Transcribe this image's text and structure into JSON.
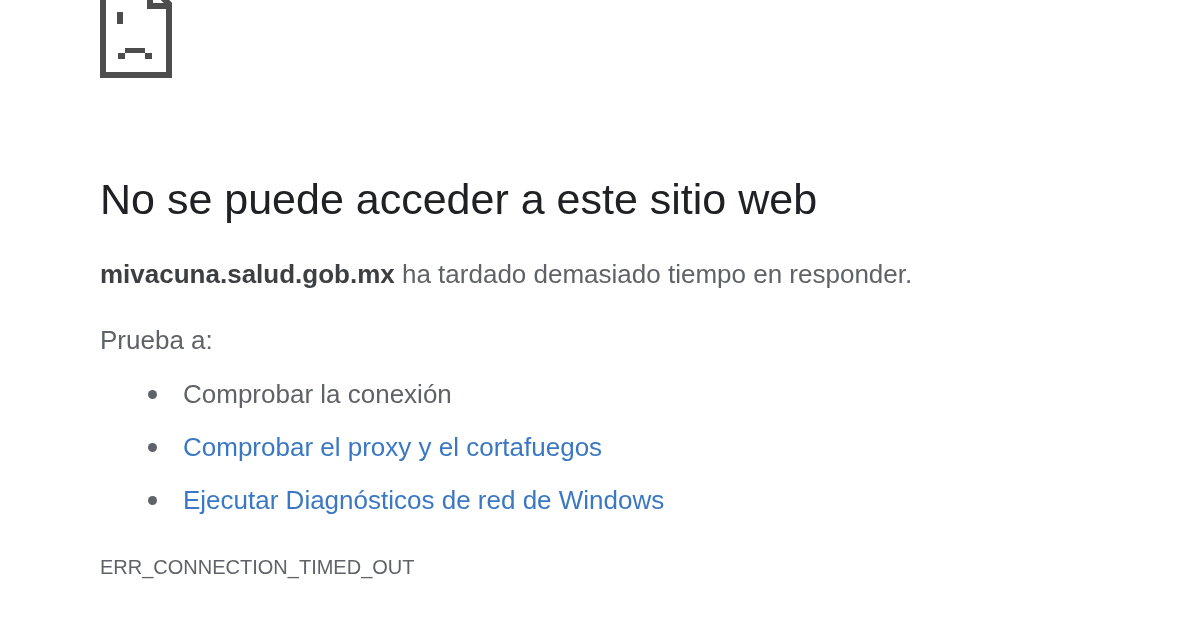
{
  "heading": "No se puede acceder a este sitio web",
  "message": "**mivacuna.salud.gob.mx** ha tardado demasiado tiempo en responder.",
  "suggestions_label": "Prueba a:",
  "suggestions": [
    {
      "text": "Comprobar la conexión",
      "kind": "text"
    },
    {
      "text": "Comprobar el proxy y el cortafuegos",
      "kind": "link"
    },
    {
      "text": "Ejecutar Diagnósticos de red de Windows",
      "kind": "link"
    }
  ],
  "error_code": "ERR_CONNECTION_TIMED_OUT"
}
